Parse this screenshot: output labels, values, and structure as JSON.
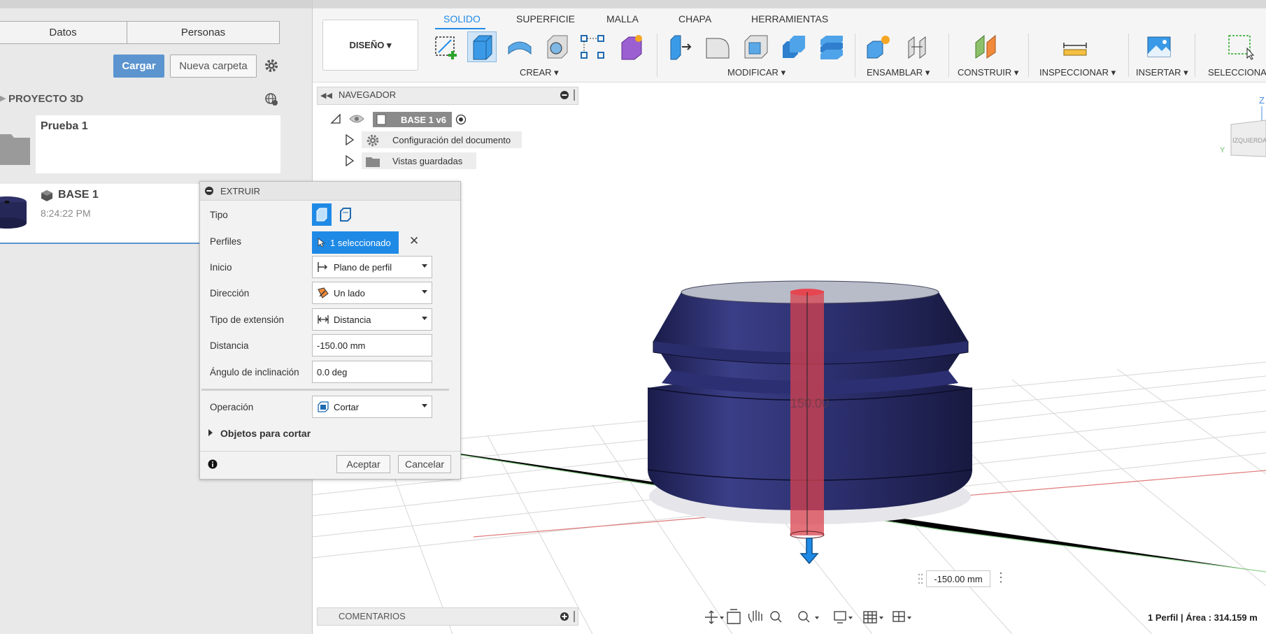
{
  "left_panel": {
    "tabs": [
      "Datos",
      "Personas"
    ],
    "upload_label": "Cargar",
    "new_folder_label": "Nueva carpeta",
    "project_name": "PROYECTO 3D",
    "items": [
      {
        "name": "Prueba 1"
      },
      {
        "name": "BASE 1",
        "time": "8:24:22 PM"
      }
    ]
  },
  "ribbon": {
    "tabs": [
      "SOLIDO",
      "SUPERFICIE",
      "MALLA",
      "CHAPA",
      "HERRAMIENTAS"
    ],
    "workspace": "DISEÑO",
    "groups": [
      "CREAR",
      "MODIFICAR",
      "ENSAMBLAR",
      "CONSTRUIR",
      "INSPECCIONAR",
      "INSERTAR",
      "SELECCIONAR"
    ]
  },
  "navigator": {
    "title": "NAVEGADOR",
    "root": "BASE 1 v6",
    "items": [
      "Configuración del documento",
      "Vistas guardadas"
    ]
  },
  "dialog": {
    "title": "EXTRUIR",
    "labels": {
      "type": "Tipo",
      "profiles": "Perfiles",
      "start": "Inicio",
      "direction": "Dirección",
      "extent_type": "Tipo de extensión",
      "distance": "Distancia",
      "taper": "Ángulo de inclinación",
      "operation": "Operación"
    },
    "values": {
      "profiles": "1 seleccionado",
      "start": "Plano de perfil",
      "direction": "Un lado",
      "extent_type": "Distancia",
      "distance": "-150.00 mm",
      "taper": "0.0 deg",
      "operation": "Cortar"
    },
    "objects_to_cut": "Objetos para cortar",
    "ok": "Aceptar",
    "cancel": "Cancelar"
  },
  "viewport": {
    "distance_input": "-150.00 mm",
    "dimension_text": "150.00",
    "comments": "COMENTARIOS",
    "status": "1 Perfil | Área : 314.159 m",
    "viewcube_face": "IZQUIERDA",
    "axis_labels": [
      "Z",
      "Y"
    ]
  },
  "colors": {
    "accent": "#1f8ae6",
    "upload": "#5b94cf",
    "model_body": "#2e3170",
    "cut_preview": "#d9434f"
  }
}
